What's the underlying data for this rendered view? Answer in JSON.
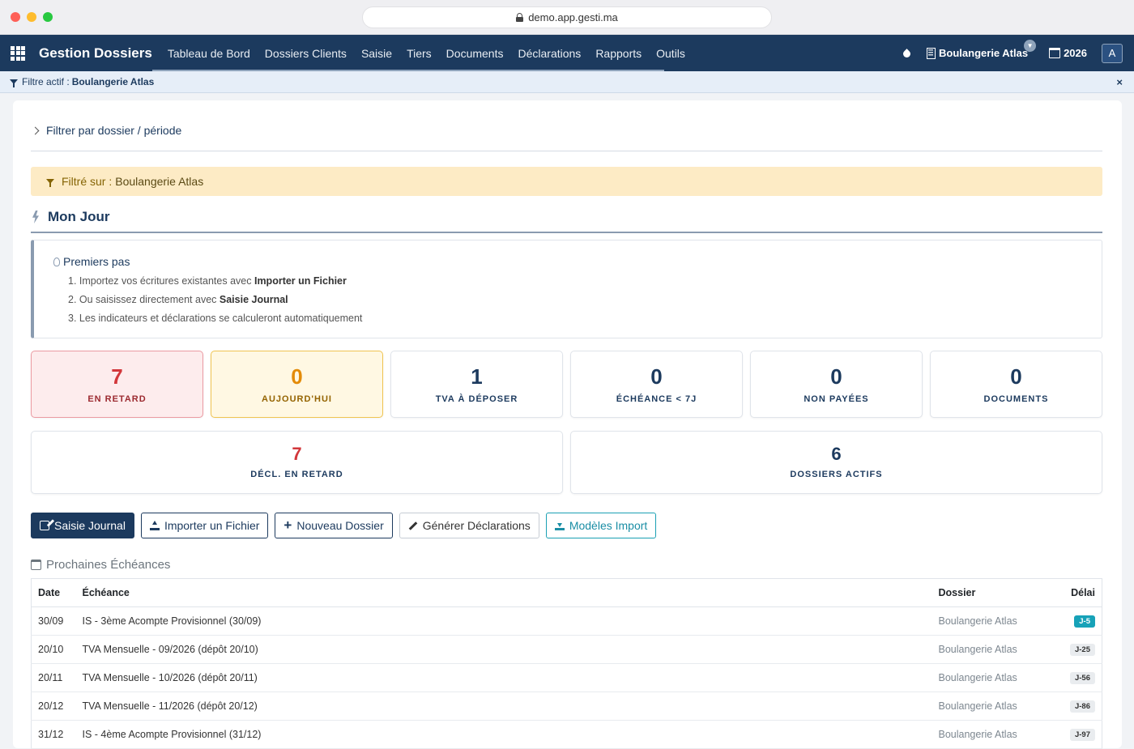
{
  "browser": {
    "url": "demo.app.gesti.ma"
  },
  "navbar": {
    "brand": "Gestion Dossiers",
    "links": [
      "Tableau de Bord",
      "Dossiers Clients",
      "Saisie",
      "Tiers",
      "Documents",
      "Déclarations",
      "Rapports",
      "Outils"
    ],
    "company": "Boulangerie Atlas",
    "year": "2026",
    "avatar": "A"
  },
  "filterbar": {
    "label": "Filtre actif :",
    "value": "Boulangerie Atlas",
    "close": "×"
  },
  "collapse": {
    "label": "Filtrer par dossier / période"
  },
  "alert": {
    "label": "Filtré sur :",
    "value": "Boulangerie Atlas"
  },
  "section": {
    "title": "Mon Jour"
  },
  "steps": {
    "title": "Premiers pas",
    "items": [
      {
        "prefix": "1. Importez vos écritures existantes avec ",
        "bold": "Importer un Fichier"
      },
      {
        "prefix": "2. Ou saisissez directement avec ",
        "bold": "Saisie Journal"
      },
      {
        "prefix": "3. Les indicateurs et déclarations se calculeront automatiquement",
        "bold": ""
      }
    ]
  },
  "kpis": [
    {
      "value": "7",
      "label": "EN RETARD"
    },
    {
      "value": "0",
      "label": "AUJOURD'HUI"
    },
    {
      "value": "1",
      "label": "TVA À DÉPOSER"
    },
    {
      "value": "0",
      "label": "ÉCHÉANCE < 7J"
    },
    {
      "value": "0",
      "label": "NON PAYÉES"
    },
    {
      "value": "0",
      "label": "DOCUMENTS"
    },
    {
      "value": "7",
      "label": "DÉCL. EN RETARD"
    },
    {
      "value": "6",
      "label": "DOSSIERS ACTIFS"
    }
  ],
  "actions": [
    "Saisie Journal",
    "Importer un Fichier",
    "Nouveau Dossier",
    "Générer Déclarations",
    "Modèles Import"
  ],
  "schedule": {
    "title": "Prochaines Échéances",
    "columns": [
      "Date",
      "Échéance",
      "Dossier",
      "Délai"
    ],
    "rows": [
      {
        "date": "30/09",
        "echeance": "IS - 3ème Acompte Provisionnel (30/09)",
        "dossier": "Boulangerie Atlas",
        "delai": "J-5"
      },
      {
        "date": "20/10",
        "echeance": "TVA Mensuelle - 09/2026 (dépôt 20/10)",
        "dossier": "Boulangerie Atlas",
        "delai": "J-25"
      },
      {
        "date": "20/11",
        "echeance": "TVA Mensuelle - 10/2026 (dépôt 20/11)",
        "dossier": "Boulangerie Atlas",
        "delai": "J-56"
      },
      {
        "date": "20/12",
        "echeance": "TVA Mensuelle - 11/2026 (dépôt 20/12)",
        "dossier": "Boulangerie Atlas",
        "delai": "J-86"
      },
      {
        "date": "31/12",
        "echeance": "IS - 4ème Acompte Provisionnel (31/12)",
        "dossier": "Boulangerie Atlas",
        "delai": "J-97"
      }
    ]
  },
  "colors": {
    "navy": "#1c3a5e",
    "danger": "#d2373b",
    "warning": "#e38b08",
    "teal": "#17a2b8"
  }
}
